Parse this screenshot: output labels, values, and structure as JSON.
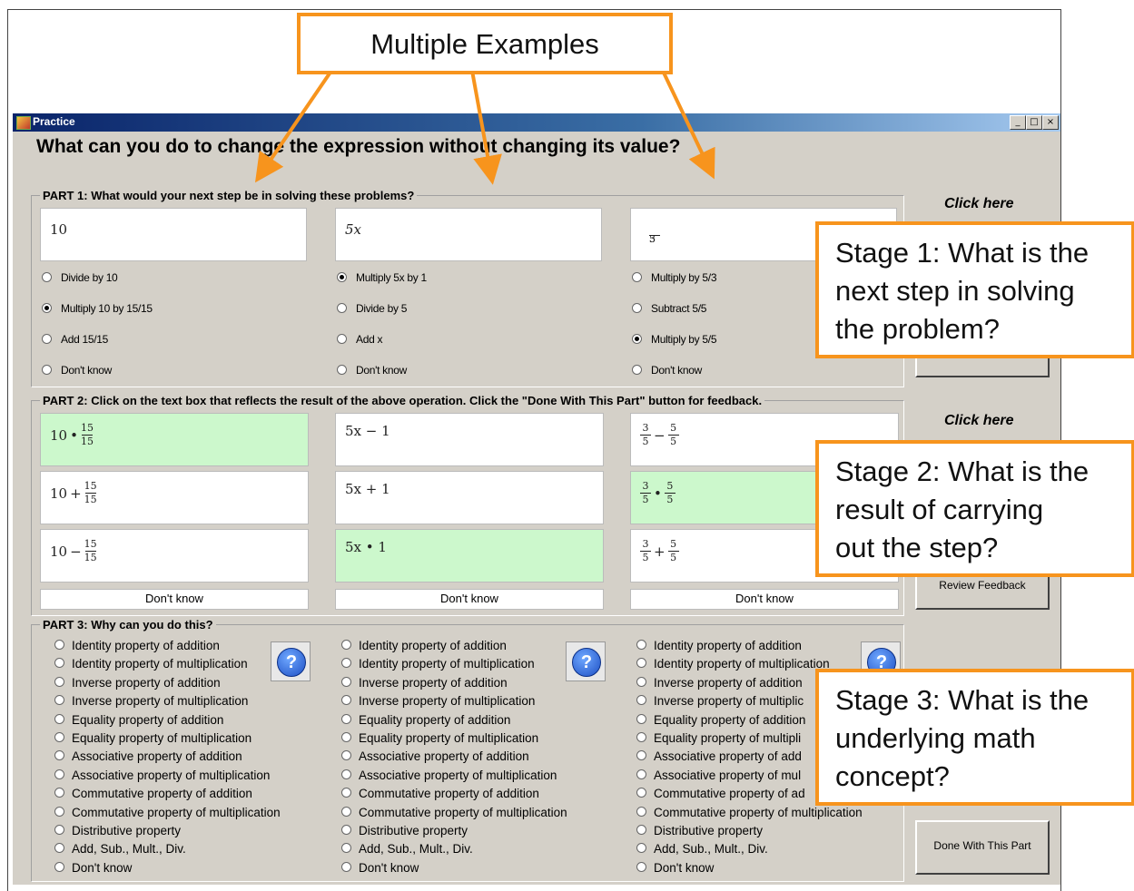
{
  "window": {
    "title": "Practice",
    "controls": [
      "_",
      "□",
      "×"
    ]
  },
  "question": "What can you do to change the expression without changing its value?",
  "callouts": {
    "top": "Multiple Examples",
    "stage1": [
      "Stage 1: What is the",
      "next step in solving",
      "the problem?"
    ],
    "stage2": [
      "Stage 2: What is the",
      "result of carrying",
      "out the step?"
    ],
    "stage3": [
      "Stage 3: What is the",
      "underlying math",
      "concept?"
    ],
    "color": "#f7941d"
  },
  "part1": {
    "label": "PART 1:  What would your next step be in solving these problems?",
    "click_here": "Click here",
    "problems": [
      {
        "expr": "10",
        "options": [
          "Divide by 10",
          "Multiply 10 by 15/15",
          "Add 15/15",
          "Don't know"
        ],
        "selected": 1
      },
      {
        "expr": "5x",
        "options": [
          "Multiply 5x by 1",
          "Divide by 5",
          "Add x",
          "Don't know"
        ],
        "selected": 0
      },
      {
        "expr_num": "3",
        "expr_den": "5",
        "options": [
          "Multiply by 5/3",
          "Subtract 5/5",
          "Multiply by 5/5",
          "Don't know"
        ],
        "selected": 2
      }
    ]
  },
  "part2": {
    "label": "PART 2:  Click on the text box that reflects the result of the above operation.  Click the \"Done With This Part\" button for feedback.",
    "click_here": "Click here",
    "review_button": "Review Feedback",
    "dont_know": "Don't know",
    "col1": {
      "base": "10",
      "ops": [
        "•",
        "+",
        "−"
      ],
      "num": "15",
      "den": "15",
      "selected": 0
    },
    "col2": {
      "items": [
        "5x − 1",
        "5x + 1",
        "5x • 1"
      ],
      "selected": 2
    },
    "col3": {
      "num_a": "3",
      "den_a": "5",
      "num_b": "5",
      "den_b": "5",
      "ops": [
        "−",
        "•",
        "+"
      ],
      "selected": 1
    }
  },
  "part3": {
    "label": "PART 3:  Why can you do this?",
    "help_glyph": "?",
    "done_button": "Done With This Part",
    "options": [
      "Identity property of addition",
      "Identity property of multiplication",
      "Inverse property of addition",
      "Inverse property of multiplication",
      "Equality property of addition",
      "Equality property of multiplication",
      "Associative property of addition",
      "Associative property of multiplication",
      "Commutative property of addition",
      "Commutative property of multiplication",
      "Distributive property",
      "Add, Sub., Mult., Div.",
      "Don't know"
    ],
    "col3_truncated": [
      "Identity property of addition",
      "Identity property of multiplication",
      "Inverse property of addition",
      "Inverse property of multiplic",
      "Equality property of addition",
      "Equality property of multipli",
      "Associative property of add",
      "Associative property of mul",
      "Commutative property of ad",
      "Commutative property of multiplication",
      "Distributive property",
      "Add, Sub., Mult., Div.",
      "Don't know"
    ]
  }
}
